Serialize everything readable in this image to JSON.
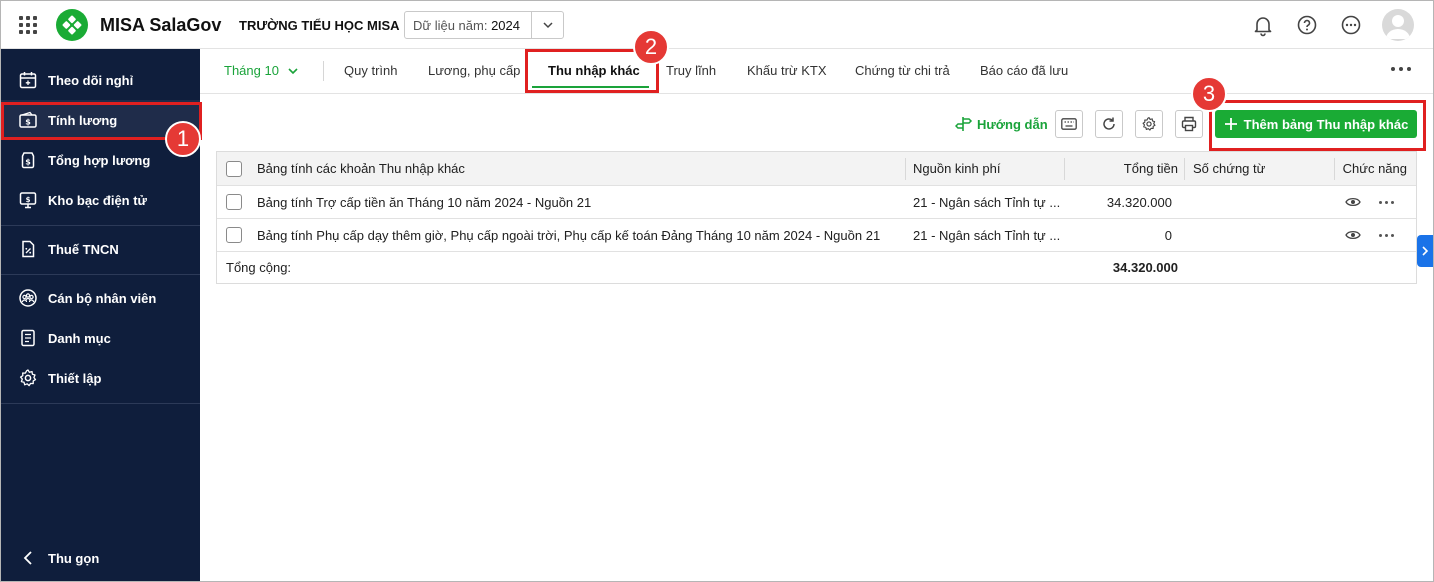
{
  "header": {
    "app_name": "MISA SalaGov",
    "school_name": "TRƯỜNG TIỂU HỌC MISA",
    "year_label": "Dữ liệu năm:",
    "year_value": "2024"
  },
  "sidebar": {
    "items": [
      {
        "label": "Theo dõi nghỉ",
        "icon": "calendar-icon"
      },
      {
        "label": "Tính lương",
        "icon": "salary-icon"
      },
      {
        "label": "Tổng hợp lương",
        "icon": "money-summary-icon"
      },
      {
        "label": "Kho bạc điện tử",
        "icon": "treasury-icon"
      },
      {
        "label": "Thuế TNCN",
        "icon": "tax-icon"
      },
      {
        "label": "Cán bộ nhân viên",
        "icon": "staff-icon"
      },
      {
        "label": "Danh mục",
        "icon": "catalog-icon"
      },
      {
        "label": "Thiết lập",
        "icon": "gear-icon"
      }
    ],
    "collapse_label": "Thu gọn"
  },
  "tabs": {
    "month": "Tháng 10",
    "items": [
      "Quy trình",
      "Lương, phụ cấp",
      "Thu nhập khác",
      "Truy lĩnh",
      "Khấu trừ KTX",
      "Chứng từ chi trả",
      "Báo cáo đã lưu"
    ],
    "active": "Thu nhập khác"
  },
  "toolbar": {
    "guide_label": "Hướng dẫn",
    "add_label": "Thêm bảng Thu nhập khác"
  },
  "table": {
    "columns": [
      "Bảng tính các khoản Thu nhập khác",
      "Nguồn kinh phí",
      "Tổng tiền",
      "Số chứng từ",
      "Chức năng"
    ],
    "rows": [
      {
        "name": "Bảng tính Trợ cấp tiền ăn Tháng 10 năm 2024 - Nguồn 21",
        "source": "21 - Ngân sách Tỉnh tự ...",
        "total": "34.320.000",
        "voucher": ""
      },
      {
        "name": "Bảng tính Phụ cấp dạy thêm giờ, Phụ cấp ngoài trời, Phụ cấp kế toán Đảng Tháng 10 năm 2024 - Nguồn 21",
        "source": "21 - Ngân sách Tỉnh tự ...",
        "total": "0",
        "voucher": ""
      }
    ],
    "total_label": "Tổng cộng:",
    "total_value": "34.320.000"
  },
  "annotations": {
    "step1": "1",
    "step2": "2",
    "step3": "3"
  },
  "colors": {
    "sidebar_bg": "#0f1e3c",
    "accent_green": "#1aab35",
    "highlight_red": "#e02020"
  }
}
